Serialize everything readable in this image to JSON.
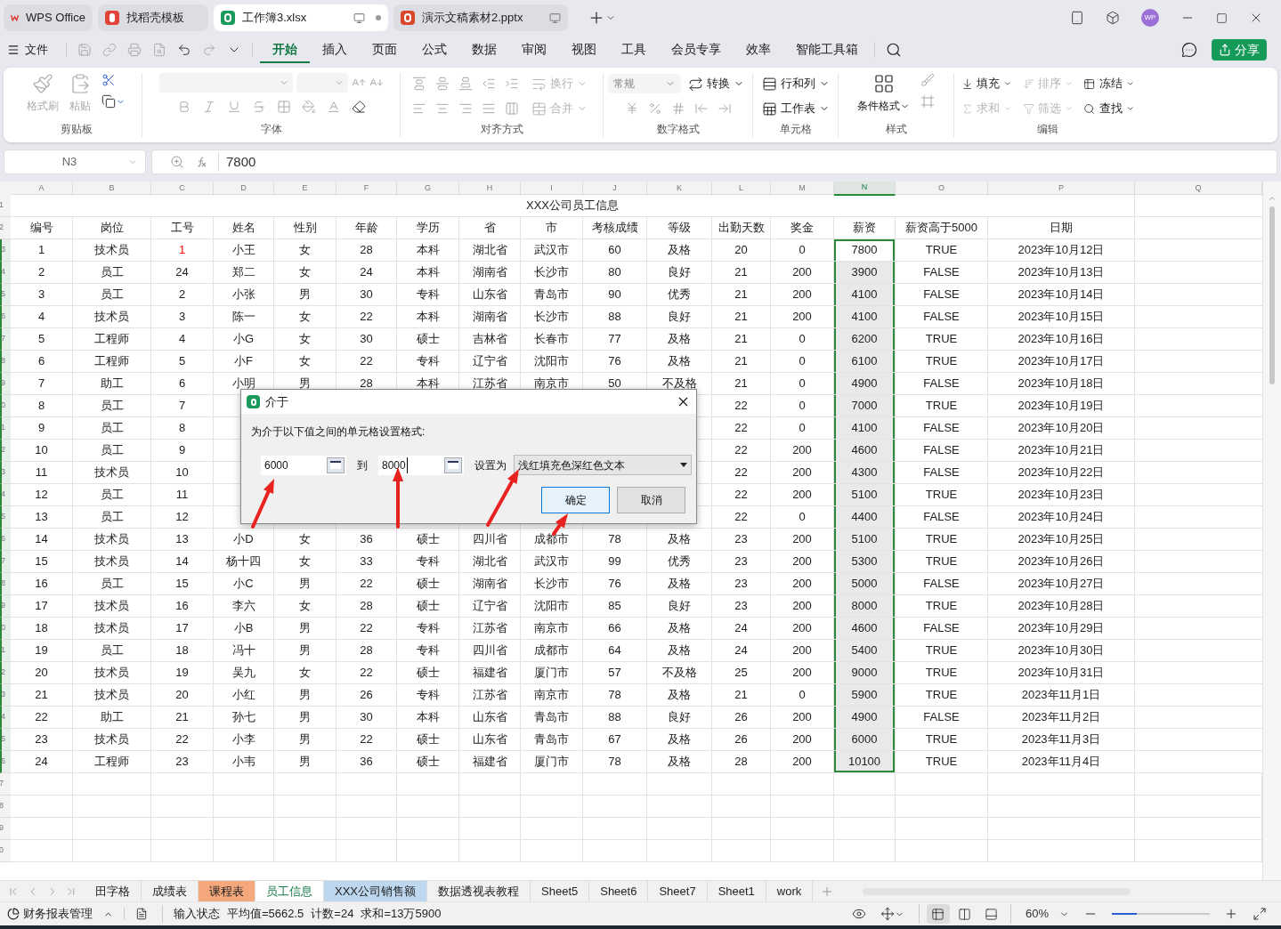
{
  "title_tabs": [
    {
      "label": "WPS Office",
      "kind": "home",
      "selected": false
    },
    {
      "label": "找稻壳模板",
      "kind": "template",
      "selected": false
    },
    {
      "label": "工作簿3.xlsx",
      "kind": "sheet",
      "selected": true
    },
    {
      "label": "演示文稿素材2.pptx",
      "kind": "slides",
      "selected": false
    }
  ],
  "avatar": "WP",
  "menu": {
    "file": "文件",
    "tabs": [
      {
        "label": "开始",
        "selected": true
      },
      {
        "label": "插入",
        "selected": false
      },
      {
        "label": "页面",
        "selected": false
      },
      {
        "label": "公式",
        "selected": false
      },
      {
        "label": "数据",
        "selected": false
      },
      {
        "label": "审阅",
        "selected": false
      },
      {
        "label": "视图",
        "selected": false
      },
      {
        "label": "工具",
        "selected": false
      },
      {
        "label": "会员专享",
        "selected": false
      },
      {
        "label": "效率",
        "selected": false
      },
      {
        "label": "智能工具箱",
        "selected": false
      }
    ],
    "share": "分享"
  },
  "ribbon": {
    "clipboard": {
      "title": "剪贴板",
      "items": [
        {
          "label": "格式刷",
          "disabled": true
        },
        {
          "label": "粘贴",
          "disabled": true
        }
      ]
    },
    "font": {
      "title": "字体"
    },
    "align": {
      "title": "对齐方式",
      "items": [
        {
          "label": "换行",
          "disabled": true
        },
        {
          "label": "合并",
          "disabled": true
        }
      ]
    },
    "number": {
      "title": "数字格式",
      "format": "常规",
      "items": [
        {
          "label": "转换",
          "disabled": false
        }
      ]
    },
    "cells": {
      "title": "单元格",
      "items": [
        {
          "label": "行和列",
          "disabled": false
        },
        {
          "label": "工作表",
          "disabled": false
        }
      ]
    },
    "style": {
      "title": "样式",
      "items": [
        {
          "label": "条件格式",
          "disabled": false
        }
      ]
    },
    "edit": {
      "title": "编辑",
      "items": [
        {
          "label": "填充",
          "disabled": false
        },
        {
          "label": "排序",
          "disabled": true
        },
        {
          "label": "冻结",
          "disabled": false
        },
        {
          "label": "求和",
          "disabled": true
        },
        {
          "label": "筛选",
          "disabled": true
        },
        {
          "label": "查找",
          "disabled": false
        }
      ]
    }
  },
  "formula_bar": {
    "cell_ref": "N3",
    "value": "7800"
  },
  "sheet": {
    "columns": [
      {
        "label": "A",
        "selected": false
      },
      {
        "label": "B",
        "selected": false
      },
      {
        "label": "C",
        "selected": false
      },
      {
        "label": "D",
        "selected": false
      },
      {
        "label": "E",
        "selected": false
      },
      {
        "label": "F",
        "selected": false
      },
      {
        "label": "G",
        "selected": false
      },
      {
        "label": "H",
        "selected": false
      },
      {
        "label": "I",
        "selected": false
      },
      {
        "label": "J",
        "selected": false
      },
      {
        "label": "K",
        "selected": false
      },
      {
        "label": "L",
        "selected": false
      },
      {
        "label": "M",
        "selected": false
      },
      {
        "label": "N",
        "selected": true
      },
      {
        "label": "O",
        "selected": false
      },
      {
        "label": "P",
        "selected": false
      },
      {
        "label": "Q",
        "selected": false
      }
    ],
    "title_row": {
      "n": "1",
      "text": "XXX公司员工信息"
    },
    "header_row": {
      "n": "2",
      "cells": [
        "编号",
        "岗位",
        "工号",
        "姓名",
        "性别",
        "年龄",
        "学历",
        "省",
        "市",
        "考核成绩",
        "等级",
        "出勤天数",
        "奖金",
        "薪资",
        "薪资高于5000",
        "日期"
      ]
    },
    "rows": [
      {
        "n": "3",
        "selected": true,
        "cells": [
          "1",
          "技术员",
          {
            "text": "1",
            "color": "#ff0000"
          },
          "小王",
          "女",
          "28",
          "本科",
          "湖北省",
          "武汉市",
          "60",
          "及格",
          "20",
          "0",
          {
            "text": "7800",
            "active": true
          },
          "TRUE",
          "2023年10月12日"
        ]
      },
      {
        "n": "4",
        "selected": true,
        "cells": [
          "2",
          "员工",
          "24",
          "郑二",
          "女",
          "24",
          "本科",
          "湖南省",
          "长沙市",
          "80",
          "良好",
          "21",
          "200",
          "3900",
          "FALSE",
          "2023年10月13日"
        ]
      },
      {
        "n": "5",
        "selected": true,
        "cells": [
          "3",
          "员工",
          "2",
          "小张",
          "男",
          "30",
          "专科",
          "山东省",
          "青岛市",
          "90",
          "优秀",
          "21",
          "200",
          "4100",
          "FALSE",
          "2023年10月14日"
        ]
      },
      {
        "n": "6",
        "selected": true,
        "cells": [
          "4",
          "技术员",
          "3",
          "陈一",
          "女",
          "22",
          "本科",
          "湖南省",
          "长沙市",
          "88",
          "良好",
          "21",
          "200",
          "4100",
          "FALSE",
          "2023年10月15日"
        ]
      },
      {
        "n": "7",
        "selected": true,
        "cells": [
          "5",
          "工程师",
          "4",
          "小G",
          "女",
          "30",
          "硕士",
          "吉林省",
          "长春市",
          "77",
          "及格",
          "21",
          "0",
          "6200",
          "TRUE",
          "2023年10月16日"
        ]
      },
      {
        "n": "8",
        "selected": true,
        "cells": [
          "6",
          "工程师",
          "5",
          "小F",
          "女",
          "22",
          "专科",
          "辽宁省",
          "沈阳市",
          "76",
          "及格",
          "21",
          "0",
          "6100",
          "TRUE",
          "2023年10月17日"
        ]
      },
      {
        "n": "9",
        "selected": true,
        "cells": [
          "7",
          "助工",
          "6",
          "小明",
          "男",
          "28",
          "本科",
          "江苏省",
          "南京市",
          "50",
          "不及格",
          "21",
          "0",
          "4900",
          "FALSE",
          "2023年10月18日"
        ]
      },
      {
        "n": "0",
        "selected": true,
        "cells": [
          "8",
          "员工",
          "7",
          null,
          null,
          null,
          null,
          null,
          null,
          null,
          null,
          "22",
          "0",
          "7000",
          "TRUE",
          "2023年10月19日"
        ]
      },
      {
        "n": "1",
        "selected": true,
        "cells": [
          "9",
          "员工",
          "8",
          null,
          null,
          null,
          null,
          null,
          null,
          null,
          null,
          "22",
          "0",
          "4100",
          "FALSE",
          "2023年10月20日"
        ]
      },
      {
        "n": "2",
        "selected": true,
        "cells": [
          "10",
          "员工",
          "9",
          null,
          null,
          null,
          null,
          null,
          null,
          null,
          null,
          "22",
          "200",
          "4600",
          "FALSE",
          "2023年10月21日"
        ]
      },
      {
        "n": "3",
        "selected": true,
        "cells": [
          "11",
          "技术员",
          "10",
          null,
          null,
          null,
          null,
          null,
          null,
          null,
          null,
          "22",
          "200",
          "4300",
          "FALSE",
          "2023年10月22日"
        ]
      },
      {
        "n": "4",
        "selected": true,
        "cells": [
          "12",
          "员工",
          "11",
          null,
          null,
          null,
          null,
          null,
          null,
          null,
          null,
          "22",
          "200",
          "5100",
          "TRUE",
          "2023年10月23日"
        ]
      },
      {
        "n": "5",
        "selected": true,
        "cells": [
          "13",
          "员工",
          "12",
          null,
          null,
          null,
          null,
          null,
          null,
          null,
          null,
          "22",
          "0",
          "4400",
          "FALSE",
          "2023年10月24日"
        ]
      },
      {
        "n": "6",
        "selected": true,
        "cells": [
          "14",
          "技术员",
          "13",
          "小D",
          "女",
          "36",
          "硕士",
          "四川省",
          "成都市",
          "78",
          "及格",
          "23",
          "200",
          "5100",
          "TRUE",
          "2023年10月25日"
        ]
      },
      {
        "n": "7",
        "selected": true,
        "cells": [
          "15",
          "技术员",
          "14",
          "杨十四",
          "女",
          "33",
          "专科",
          "湖北省",
          "武汉市",
          "99",
          "优秀",
          "23",
          "200",
          "5300",
          "TRUE",
          "2023年10月26日"
        ]
      },
      {
        "n": "8",
        "selected": true,
        "cells": [
          "16",
          "员工",
          "15",
          "小C",
          "男",
          "22",
          "硕士",
          "湖南省",
          "长沙市",
          "76",
          "及格",
          "23",
          "200",
          "5000",
          "FALSE",
          "2023年10月27日"
        ]
      },
      {
        "n": "9",
        "selected": true,
        "cells": [
          "17",
          "技术员",
          "16",
          "李六",
          "女",
          "28",
          "硕士",
          "辽宁省",
          "沈阳市",
          "85",
          "良好",
          "23",
          "200",
          "8000",
          "TRUE",
          "2023年10月28日"
        ]
      },
      {
        "n": "0",
        "selected": true,
        "cells": [
          "18",
          "技术员",
          "17",
          "小B",
          "男",
          "22",
          "专科",
          "江苏省",
          "南京市",
          "66",
          "及格",
          "24",
          "200",
          "4600",
          "FALSE",
          "2023年10月29日"
        ]
      },
      {
        "n": "1",
        "selected": true,
        "cells": [
          "19",
          "员工",
          "18",
          "冯十",
          "男",
          "28",
          "专科",
          "四川省",
          "成都市",
          "64",
          "及格",
          "24",
          "200",
          "5400",
          "TRUE",
          "2023年10月30日"
        ]
      },
      {
        "n": "2",
        "selected": true,
        "cells": [
          "20",
          "技术员",
          "19",
          "吴九",
          "女",
          "22",
          "硕士",
          "福建省",
          "厦门市",
          "57",
          "不及格",
          "25",
          "200",
          "9000",
          "TRUE",
          "2023年10月31日"
        ]
      },
      {
        "n": "3",
        "selected": true,
        "cells": [
          "21",
          "技术员",
          "20",
          "小红",
          "男",
          "26",
          "专科",
          "江苏省",
          "南京市",
          "78",
          "及格",
          "21",
          "0",
          "5900",
          "TRUE",
          "2023年11月1日"
        ]
      },
      {
        "n": "4",
        "selected": true,
        "cells": [
          "22",
          "助工",
          "21",
          "孙七",
          "男",
          "30",
          "本科",
          "山东省",
          "青岛市",
          "88",
          "良好",
          "26",
          "200",
          "4900",
          "FALSE",
          "2023年11月2日"
        ]
      },
      {
        "n": "5",
        "selected": true,
        "cells": [
          "23",
          "技术员",
          "22",
          "小李",
          "男",
          "22",
          "硕士",
          "山东省",
          "青岛市",
          "67",
          "及格",
          "26",
          "200",
          "6000",
          "TRUE",
          "2023年11月3日"
        ]
      },
      {
        "n": "6",
        "selected": true,
        "cells": [
          "24",
          "工程师",
          "23",
          "小韦",
          "男",
          "36",
          "硕士",
          "福建省",
          "厦门市",
          "78",
          "及格",
          "28",
          "200",
          "10100",
          "TRUE",
          "2023年11月4日"
        ]
      }
    ],
    "empty_rows": [
      {
        "n": "7"
      },
      {
        "n": "8"
      },
      {
        "n": "9"
      },
      {
        "n": "0"
      }
    ]
  },
  "dialog": {
    "title": "介于",
    "prompt": "为介于以下值之间的单元格设置格式:",
    "from": "6000",
    "to_label": "到",
    "to": "8000",
    "set_as_label": "设置为",
    "format": "浅红填充色深红色文本",
    "buttons": [
      {
        "label": "确定",
        "default": true
      },
      {
        "label": "取消",
        "default": false
      }
    ]
  },
  "sheet_tabs": [
    {
      "label": "田字格",
      "selected": false
    },
    {
      "label": "成绩表",
      "selected": false
    },
    {
      "label": "课程表",
      "selected": false,
      "color": "#f4a87c"
    },
    {
      "label": "员工信息",
      "selected": true
    },
    {
      "label": "XXX公司销售额",
      "selected": false,
      "color": "#bdd7ee"
    },
    {
      "label": "数据透视表教程",
      "selected": false
    },
    {
      "label": "Sheet5",
      "selected": false
    },
    {
      "label": "Sheet6",
      "selected": false
    },
    {
      "label": "Sheet7",
      "selected": false
    },
    {
      "label": "Sheet1",
      "selected": false
    },
    {
      "label": "work",
      "selected": false
    }
  ],
  "status_bar": {
    "app": "财务报表管理",
    "mode": "输入状态",
    "stats": [
      "平均值=5662.5",
      "计数=24",
      "求和=13万5900"
    ],
    "views": [
      {
        "selected": true
      },
      {
        "selected": false
      },
      {
        "selected": false
      }
    ],
    "zoom": "60%",
    "zoom_level": {
      "level": 0.25
    }
  }
}
